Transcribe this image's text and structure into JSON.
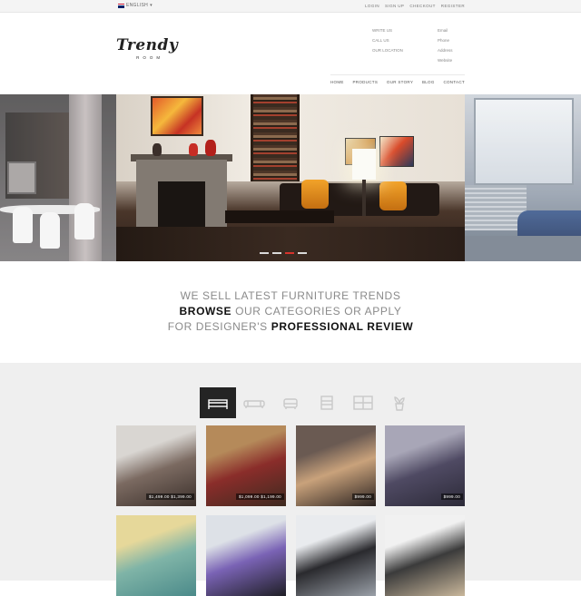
{
  "topbar": {
    "language": "ENGLISH",
    "links": [
      "LOGIN",
      "SIGN UP",
      "CHECKOUT",
      "REGISTER"
    ]
  },
  "header": {
    "logo_main": "Trendy",
    "logo_sub": "ROOM",
    "contacts_left": [
      "WRITE US",
      "CALL US",
      "OUR LOCATION"
    ],
    "contacts_right": [
      "Email",
      "Phone",
      "Address",
      "Website"
    ]
  },
  "nav": {
    "items": [
      "HOME",
      "PRODUCTS",
      "OUR STORY",
      "BLOG",
      "CONTACT"
    ]
  },
  "hero": {
    "slides_count": 4,
    "active_slide": 2,
    "colors": {
      "active_dot": "#d6332c",
      "dot": "#d9d9d9"
    }
  },
  "tagline": {
    "line1": "WE SELL LATEST FURNITURE TRENDS",
    "line2_bold": "BROWSE",
    "line2_rest": " OUR CATEGORIES OR APPLY",
    "line3_pre": "FOR DESIGNER'S ",
    "line3_bold": "PROFESSIONAL REVIEW"
  },
  "categories": {
    "tabs": [
      {
        "icon": "bed-icon",
        "active": true
      },
      {
        "icon": "sofa-icon",
        "active": false
      },
      {
        "icon": "armchair-icon",
        "active": false
      },
      {
        "icon": "cabinet-icon",
        "active": false
      },
      {
        "icon": "bookshelf-icon",
        "active": false
      },
      {
        "icon": "plant-icon",
        "active": false
      }
    ]
  },
  "products": [
    {
      "price": "$1,499.00 $1,399.00",
      "palette": [
        "#d9d6d2",
        "#7b6a61",
        "#3a2f2a"
      ]
    },
    {
      "price": "$1,099.00 $1,199.00",
      "palette": [
        "#b58a5a",
        "#8a2d2a",
        "#3d2a20"
      ]
    },
    {
      "price": "$999.00",
      "palette": [
        "#6a5a52",
        "#c9a27b",
        "#2a2220"
      ]
    },
    {
      "price": "$999.00",
      "palette": [
        "#a8a6b7",
        "#4f4a63",
        "#2c2a38"
      ]
    },
    {
      "price": "",
      "palette": [
        "#e6d89a",
        "#7fb4a7",
        "#4b8a8a"
      ]
    },
    {
      "price": "",
      "palette": [
        "#dde1e7",
        "#7a63b5",
        "#1f1f26"
      ]
    },
    {
      "price": "",
      "palette": [
        "#e9ebee",
        "#2a2a2e",
        "#9aa0a8"
      ]
    },
    {
      "price": "",
      "palette": [
        "#f1f1f1",
        "#3b3b3b",
        "#c9b79b"
      ]
    }
  ]
}
